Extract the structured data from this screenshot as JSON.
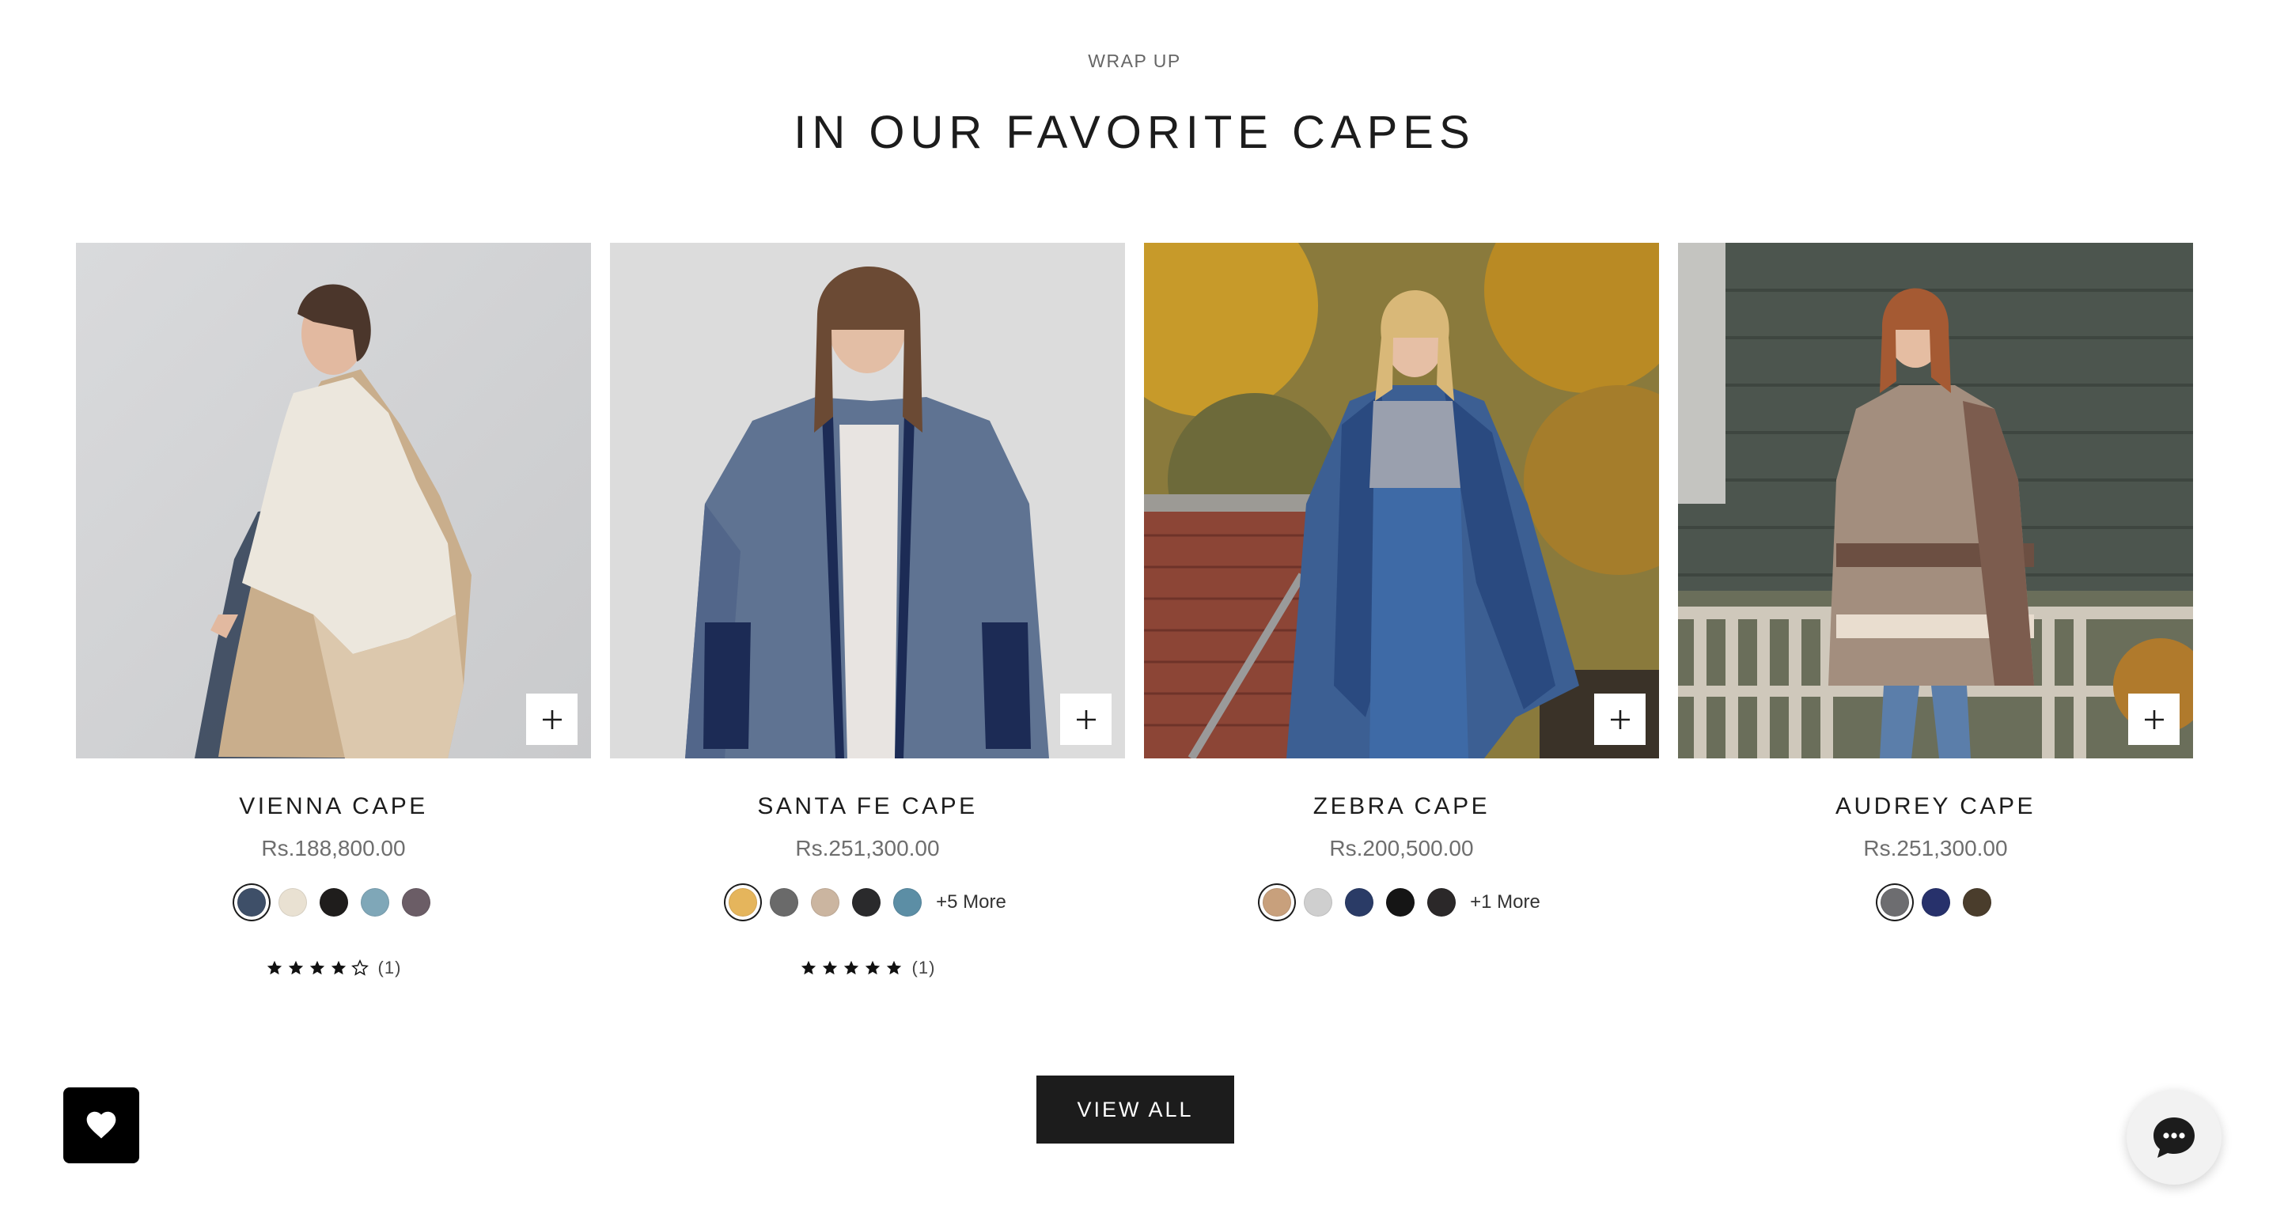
{
  "section": {
    "eyebrow": "WRAP UP",
    "title": "IN OUR FAVORITE CAPES"
  },
  "products": [
    {
      "name": "VIENNA CAPE",
      "price": "Rs.188,800.00",
      "swatches": [
        "#3e4f68",
        "#e9e1d2",
        "#1f1d1c",
        "#7fa7b8",
        "#6b5d66"
      ],
      "selected_swatch": 0,
      "more_label": "",
      "rating": {
        "stars": 4,
        "count": "(1)"
      },
      "quick_add_icon": "plus-icon",
      "image_alt": "Woman wearing ivory and camel reversible cape"
    },
    {
      "name": "SANTA FE CAPE",
      "price": "Rs.251,300.00",
      "swatches": [
        "#e5b55c",
        "#6a6a6a",
        "#cbb5a0",
        "#2a2a2c",
        "#5c8ea5"
      ],
      "selected_swatch": 0,
      "more_label": "+5 More",
      "rating": {
        "stars": 5,
        "count": "(1)"
      },
      "quick_add_icon": "plus-icon",
      "image_alt": "Woman wearing blue-grey fringed cape"
    },
    {
      "name": "ZEBRA CAPE",
      "price": "Rs.200,500.00",
      "swatches": [
        "#c8a07c",
        "#cfcfcf",
        "#2a3b66",
        "#151515",
        "#2b2829"
      ],
      "selected_swatch": 0,
      "more_label": "+1 More",
      "rating": null,
      "quick_add_icon": "plus-icon",
      "image_alt": "Woman in blue striped cape walking outdoors in autumn"
    },
    {
      "name": "AUDREY CAPE",
      "price": "Rs.251,300.00",
      "swatches": [
        "#6d6d70",
        "#27316b",
        "#4a3d2c"
      ],
      "selected_swatch": 0,
      "more_label": "",
      "rating": null,
      "quick_add_icon": "plus-icon",
      "image_alt": "Woman in taupe plaid buttoned cape beside a bench"
    }
  ],
  "cta": {
    "view_all": "VIEW ALL"
  },
  "widgets": {
    "wishlist_icon": "heart-icon",
    "chat_icon": "chat-bubble-icon"
  }
}
